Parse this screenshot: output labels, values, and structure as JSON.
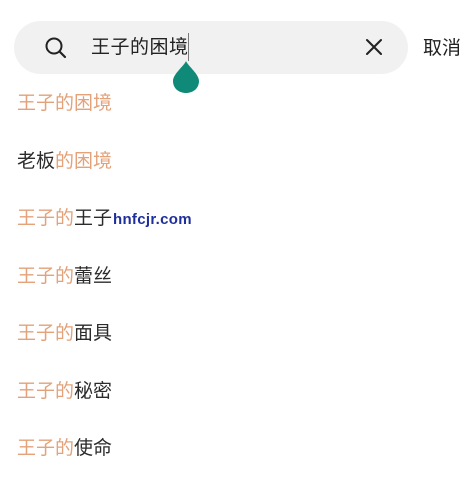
{
  "search": {
    "query": "王子的困境",
    "cancel_label": "取消"
  },
  "suggestions": [
    {
      "highlight": "王子的困境",
      "rest": ""
    },
    {
      "rest_before": "老板",
      "highlight": "的困境",
      "rest": ""
    },
    {
      "highlight": "王子的",
      "rest": "王子"
    },
    {
      "highlight": "王子的",
      "rest": "蕾丝"
    },
    {
      "highlight": "王子的",
      "rest": "面具"
    },
    {
      "highlight": "王子的",
      "rest": "秘密"
    },
    {
      "highlight": "王子的",
      "rest": "使命"
    }
  ],
  "watermark": "hnfcjr.com",
  "colors": {
    "highlight": "#e3a27a",
    "handle": "#0f8a79",
    "search_bg": "#f1f1f1"
  },
  "icons": {
    "search": "search-icon",
    "clear": "close-icon",
    "cursor_handle": "text-cursor-handle-icon"
  }
}
